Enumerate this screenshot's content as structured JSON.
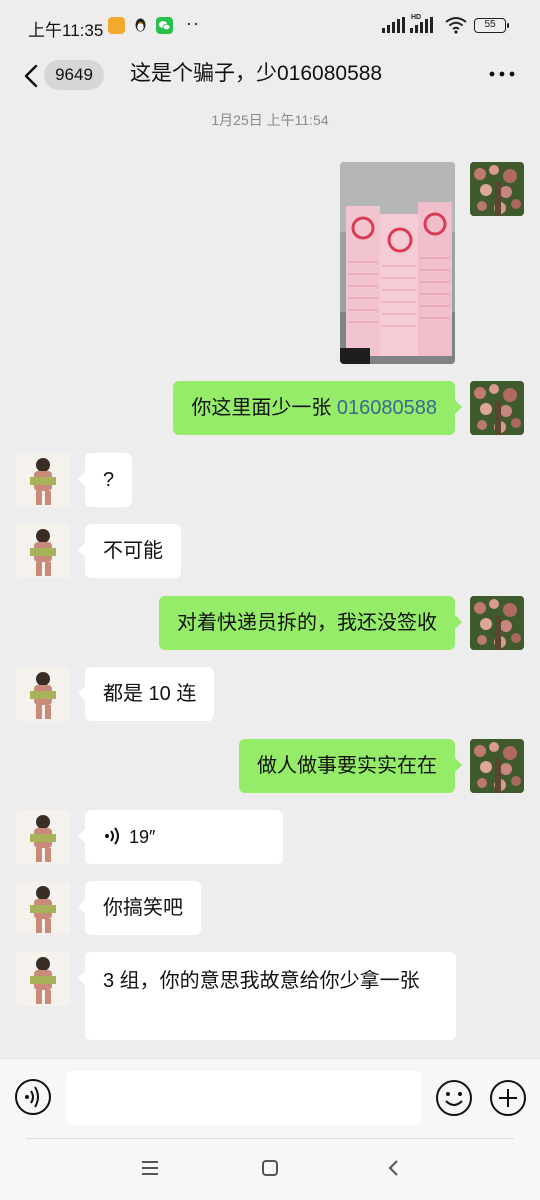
{
  "status_bar": {
    "time": "上午11:35",
    "hd": "HD",
    "battery": "55"
  },
  "header": {
    "unread_count": "9649",
    "title": "这是个骗子，少016080588"
  },
  "timestamp": "1月25日 上午11:54",
  "messages": [
    {
      "sender": "me",
      "type": "image"
    },
    {
      "sender": "me",
      "type": "text",
      "text_prefix": "你这里面少一张 ",
      "text_link": "016080588"
    },
    {
      "sender": "other",
      "type": "text",
      "text": "?"
    },
    {
      "sender": "other",
      "type": "text",
      "text": "不可能"
    },
    {
      "sender": "me",
      "type": "text",
      "text": "对着快递员拆的，我还没签收"
    },
    {
      "sender": "other",
      "type": "text",
      "text": "都是 10 连"
    },
    {
      "sender": "me",
      "type": "text",
      "text": "做人做事要实实在在"
    },
    {
      "sender": "other",
      "type": "voice",
      "duration": "19″"
    },
    {
      "sender": "other",
      "type": "text",
      "text": "你搞笑吧"
    },
    {
      "sender": "other",
      "type": "text",
      "text": "3 组，你的意思我故意给你少拿一张"
    }
  ],
  "input": {
    "placeholder": ""
  },
  "colors": {
    "background": "#ededed",
    "my_bubble": "#95ec69",
    "their_bubble": "#ffffff",
    "link_number": "#3a6a8f"
  }
}
